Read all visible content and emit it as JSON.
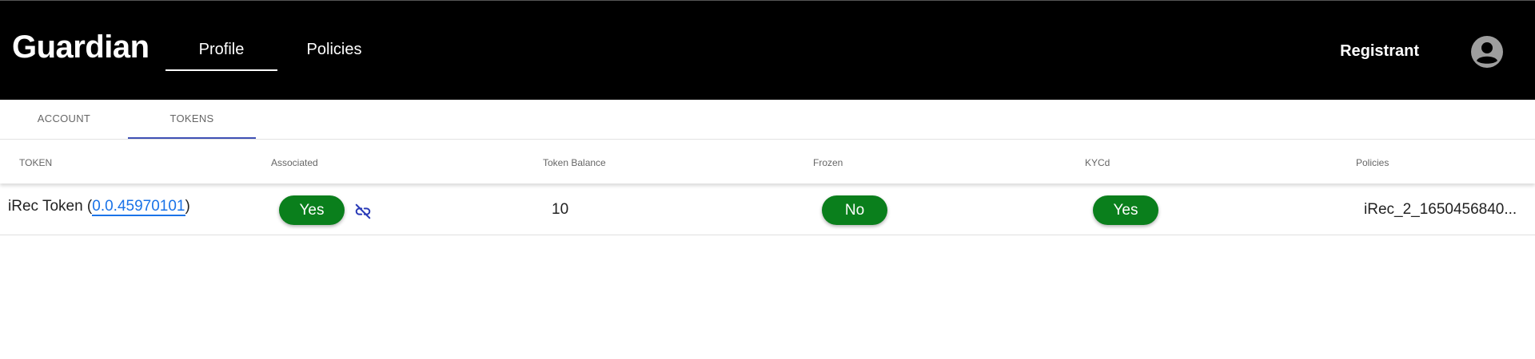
{
  "header": {
    "brand": "Guardian",
    "nav": [
      {
        "label": "Profile",
        "active": true
      },
      {
        "label": "Policies",
        "active": false
      }
    ],
    "user": {
      "name": "Registrant",
      "icon": "account-circle-icon"
    },
    "background": "#000000"
  },
  "tabs": [
    {
      "label": "ACCOUNT",
      "active": false
    },
    {
      "label": "TOKENS",
      "active": true
    }
  ],
  "table": {
    "columns": [
      "TOKEN",
      "Associated",
      "Token Balance",
      "Frozen",
      "KYCd",
      "Policies"
    ],
    "rows": [
      {
        "token_name": "iRec Token",
        "token_open": " (",
        "token_id": "0.0.45970101",
        "token_close": ")",
        "associated": "Yes",
        "associated_action_icon": "link-off-icon",
        "balance": "10",
        "frozen": "No",
        "kycd": "Yes",
        "policies": "iRec_2_1650456840..."
      }
    ]
  },
  "colors": {
    "accent": "#3f51b5",
    "link": "#1a73e8",
    "status_pill": "#0a7f1c"
  }
}
